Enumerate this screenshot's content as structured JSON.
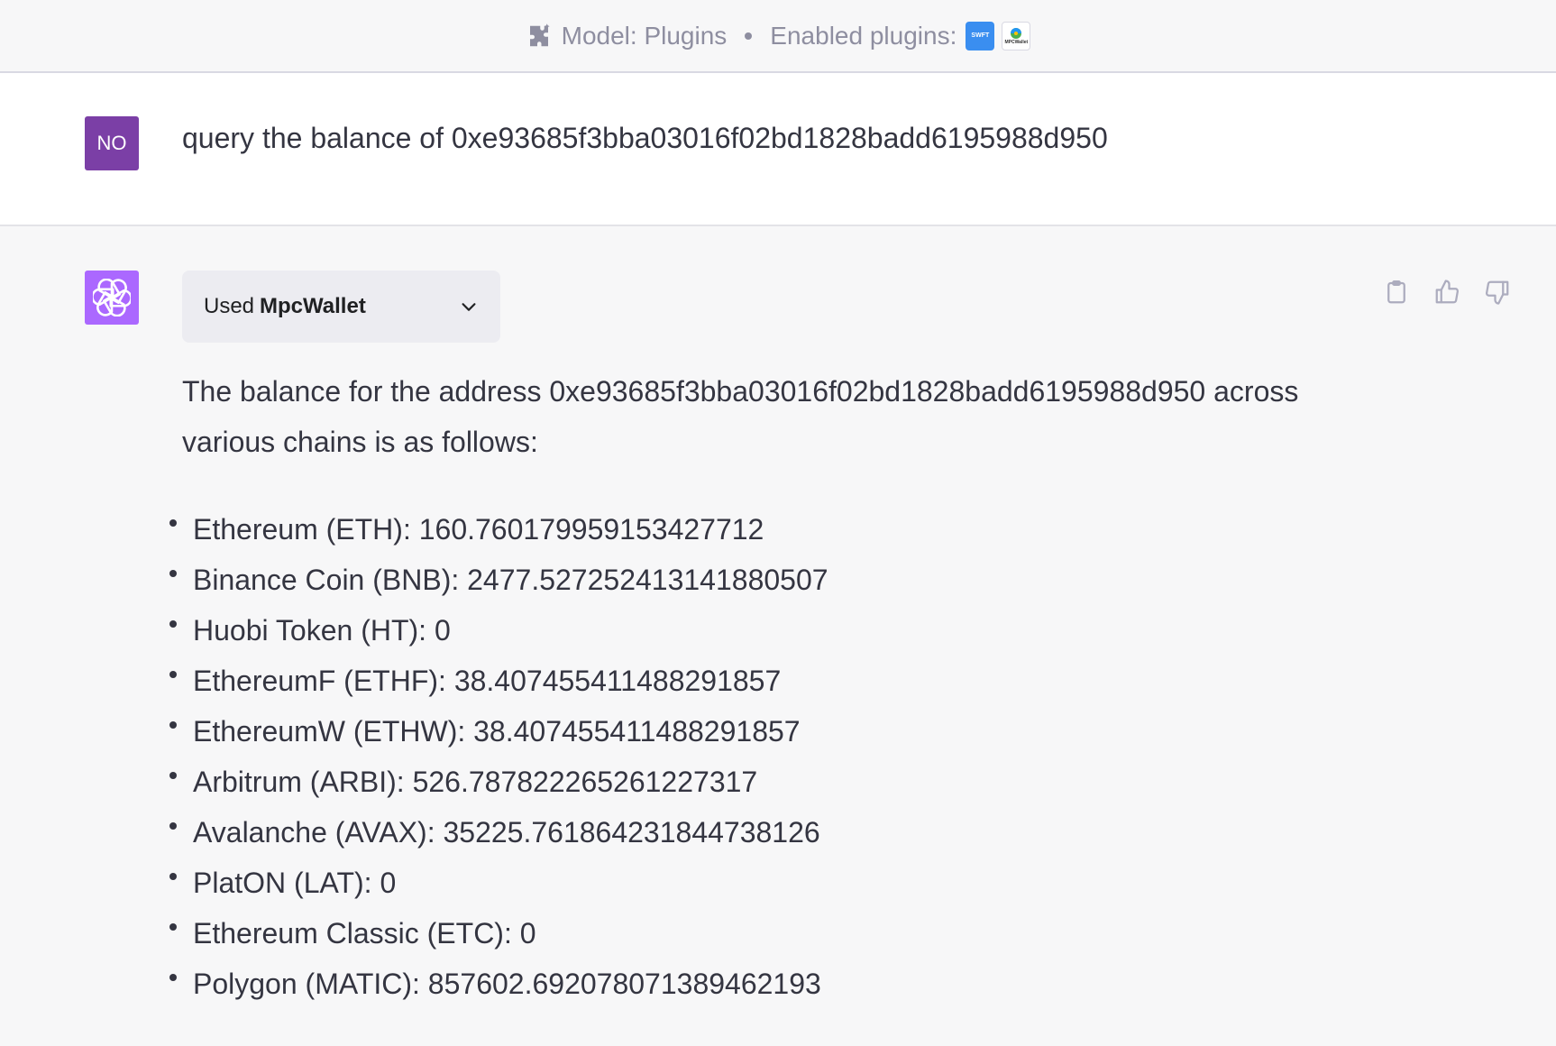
{
  "header": {
    "model_label": "Model: Plugins",
    "enabled_label": "Enabled plugins:",
    "plugins": [
      {
        "name": "swft-plugin-icon",
        "text": "SWFT"
      },
      {
        "name": "mpcwallet-plugin-icon",
        "text": "MPCWallet"
      }
    ]
  },
  "user_message": {
    "avatar_initials": "NO",
    "text": "query the balance of 0xe93685f3bba03016f02bd1828badd6195988d950"
  },
  "assistant_message": {
    "plugin_used": {
      "prefix": "Used",
      "name": "MpcWallet"
    },
    "intro": "The balance for the address 0xe93685f3bba03016f02bd1828badd6195988d950 across various chains is as follows:",
    "balances": [
      "Ethereum (ETH): 160.760179959153427712",
      "Binance Coin (BNB): 2477.527252413141880507",
      "Huobi Token (HT): 0",
      "EthereumF (ETHF): 38.407455411488291857",
      "EthereumW (ETHW): 38.407455411488291857",
      "Arbitrum (ARBI): 526.787822265261227317",
      "Avalanche (AVAX): 35225.761864231844738126",
      "PlatON (LAT): 0",
      "Ethereum Classic (ETC): 0",
      "Polygon (MATIC): 857602.692078071389462193"
    ]
  },
  "colors": {
    "user_avatar": "#7b3fa6",
    "assistant_avatar": "#ab68ff",
    "swft_badge": "#3a8ef0"
  }
}
